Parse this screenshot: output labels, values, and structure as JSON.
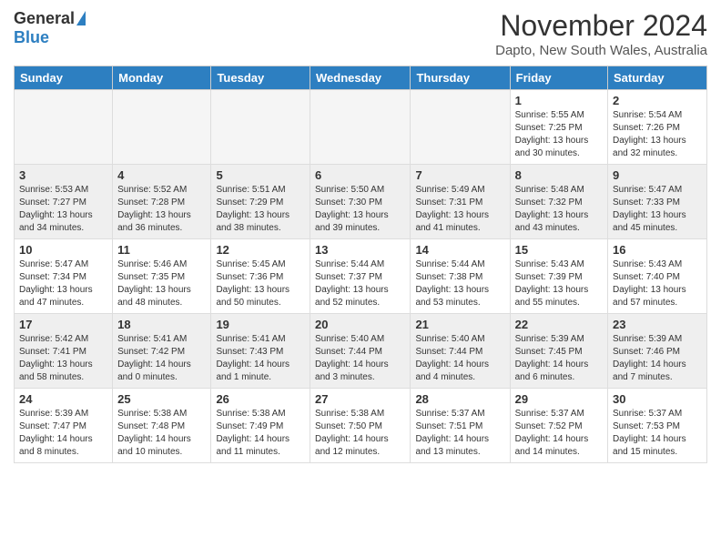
{
  "logo": {
    "general": "General",
    "blue": "Blue"
  },
  "header": {
    "title": "November 2024",
    "subtitle": "Dapto, New South Wales, Australia"
  },
  "weekdays": [
    "Sunday",
    "Monday",
    "Tuesday",
    "Wednesday",
    "Thursday",
    "Friday",
    "Saturday"
  ],
  "weeks": [
    [
      {
        "day": "",
        "sunrise": "",
        "sunset": "",
        "daylight": ""
      },
      {
        "day": "",
        "sunrise": "",
        "sunset": "",
        "daylight": ""
      },
      {
        "day": "",
        "sunrise": "",
        "sunset": "",
        "daylight": ""
      },
      {
        "day": "",
        "sunrise": "",
        "sunset": "",
        "daylight": ""
      },
      {
        "day": "",
        "sunrise": "",
        "sunset": "",
        "daylight": ""
      },
      {
        "day": "1",
        "sunrise": "Sunrise: 5:55 AM",
        "sunset": "Sunset: 7:25 PM",
        "daylight": "Daylight: 13 hours and 30 minutes."
      },
      {
        "day": "2",
        "sunrise": "Sunrise: 5:54 AM",
        "sunset": "Sunset: 7:26 PM",
        "daylight": "Daylight: 13 hours and 32 minutes."
      }
    ],
    [
      {
        "day": "3",
        "sunrise": "Sunrise: 5:53 AM",
        "sunset": "Sunset: 7:27 PM",
        "daylight": "Daylight: 13 hours and 34 minutes."
      },
      {
        "day": "4",
        "sunrise": "Sunrise: 5:52 AM",
        "sunset": "Sunset: 7:28 PM",
        "daylight": "Daylight: 13 hours and 36 minutes."
      },
      {
        "day": "5",
        "sunrise": "Sunrise: 5:51 AM",
        "sunset": "Sunset: 7:29 PM",
        "daylight": "Daylight: 13 hours and 38 minutes."
      },
      {
        "day": "6",
        "sunrise": "Sunrise: 5:50 AM",
        "sunset": "Sunset: 7:30 PM",
        "daylight": "Daylight: 13 hours and 39 minutes."
      },
      {
        "day": "7",
        "sunrise": "Sunrise: 5:49 AM",
        "sunset": "Sunset: 7:31 PM",
        "daylight": "Daylight: 13 hours and 41 minutes."
      },
      {
        "day": "8",
        "sunrise": "Sunrise: 5:48 AM",
        "sunset": "Sunset: 7:32 PM",
        "daylight": "Daylight: 13 hours and 43 minutes."
      },
      {
        "day": "9",
        "sunrise": "Sunrise: 5:47 AM",
        "sunset": "Sunset: 7:33 PM",
        "daylight": "Daylight: 13 hours and 45 minutes."
      }
    ],
    [
      {
        "day": "10",
        "sunrise": "Sunrise: 5:47 AM",
        "sunset": "Sunset: 7:34 PM",
        "daylight": "Daylight: 13 hours and 47 minutes."
      },
      {
        "day": "11",
        "sunrise": "Sunrise: 5:46 AM",
        "sunset": "Sunset: 7:35 PM",
        "daylight": "Daylight: 13 hours and 48 minutes."
      },
      {
        "day": "12",
        "sunrise": "Sunrise: 5:45 AM",
        "sunset": "Sunset: 7:36 PM",
        "daylight": "Daylight: 13 hours and 50 minutes."
      },
      {
        "day": "13",
        "sunrise": "Sunrise: 5:44 AM",
        "sunset": "Sunset: 7:37 PM",
        "daylight": "Daylight: 13 hours and 52 minutes."
      },
      {
        "day": "14",
        "sunrise": "Sunrise: 5:44 AM",
        "sunset": "Sunset: 7:38 PM",
        "daylight": "Daylight: 13 hours and 53 minutes."
      },
      {
        "day": "15",
        "sunrise": "Sunrise: 5:43 AM",
        "sunset": "Sunset: 7:39 PM",
        "daylight": "Daylight: 13 hours and 55 minutes."
      },
      {
        "day": "16",
        "sunrise": "Sunrise: 5:43 AM",
        "sunset": "Sunset: 7:40 PM",
        "daylight": "Daylight: 13 hours and 57 minutes."
      }
    ],
    [
      {
        "day": "17",
        "sunrise": "Sunrise: 5:42 AM",
        "sunset": "Sunset: 7:41 PM",
        "daylight": "Daylight: 13 hours and 58 minutes."
      },
      {
        "day": "18",
        "sunrise": "Sunrise: 5:41 AM",
        "sunset": "Sunset: 7:42 PM",
        "daylight": "Daylight: 14 hours and 0 minutes."
      },
      {
        "day": "19",
        "sunrise": "Sunrise: 5:41 AM",
        "sunset": "Sunset: 7:43 PM",
        "daylight": "Daylight: 14 hours and 1 minute."
      },
      {
        "day": "20",
        "sunrise": "Sunrise: 5:40 AM",
        "sunset": "Sunset: 7:44 PM",
        "daylight": "Daylight: 14 hours and 3 minutes."
      },
      {
        "day": "21",
        "sunrise": "Sunrise: 5:40 AM",
        "sunset": "Sunset: 7:44 PM",
        "daylight": "Daylight: 14 hours and 4 minutes."
      },
      {
        "day": "22",
        "sunrise": "Sunrise: 5:39 AM",
        "sunset": "Sunset: 7:45 PM",
        "daylight": "Daylight: 14 hours and 6 minutes."
      },
      {
        "day": "23",
        "sunrise": "Sunrise: 5:39 AM",
        "sunset": "Sunset: 7:46 PM",
        "daylight": "Daylight: 14 hours and 7 minutes."
      }
    ],
    [
      {
        "day": "24",
        "sunrise": "Sunrise: 5:39 AM",
        "sunset": "Sunset: 7:47 PM",
        "daylight": "Daylight: 14 hours and 8 minutes."
      },
      {
        "day": "25",
        "sunrise": "Sunrise: 5:38 AM",
        "sunset": "Sunset: 7:48 PM",
        "daylight": "Daylight: 14 hours and 10 minutes."
      },
      {
        "day": "26",
        "sunrise": "Sunrise: 5:38 AM",
        "sunset": "Sunset: 7:49 PM",
        "daylight": "Daylight: 14 hours and 11 minutes."
      },
      {
        "day": "27",
        "sunrise": "Sunrise: 5:38 AM",
        "sunset": "Sunset: 7:50 PM",
        "daylight": "Daylight: 14 hours and 12 minutes."
      },
      {
        "day": "28",
        "sunrise": "Sunrise: 5:37 AM",
        "sunset": "Sunset: 7:51 PM",
        "daylight": "Daylight: 14 hours and 13 minutes."
      },
      {
        "day": "29",
        "sunrise": "Sunrise: 5:37 AM",
        "sunset": "Sunset: 7:52 PM",
        "daylight": "Daylight: 14 hours and 14 minutes."
      },
      {
        "day": "30",
        "sunrise": "Sunrise: 5:37 AM",
        "sunset": "Sunset: 7:53 PM",
        "daylight": "Daylight: 14 hours and 15 minutes."
      }
    ]
  ]
}
